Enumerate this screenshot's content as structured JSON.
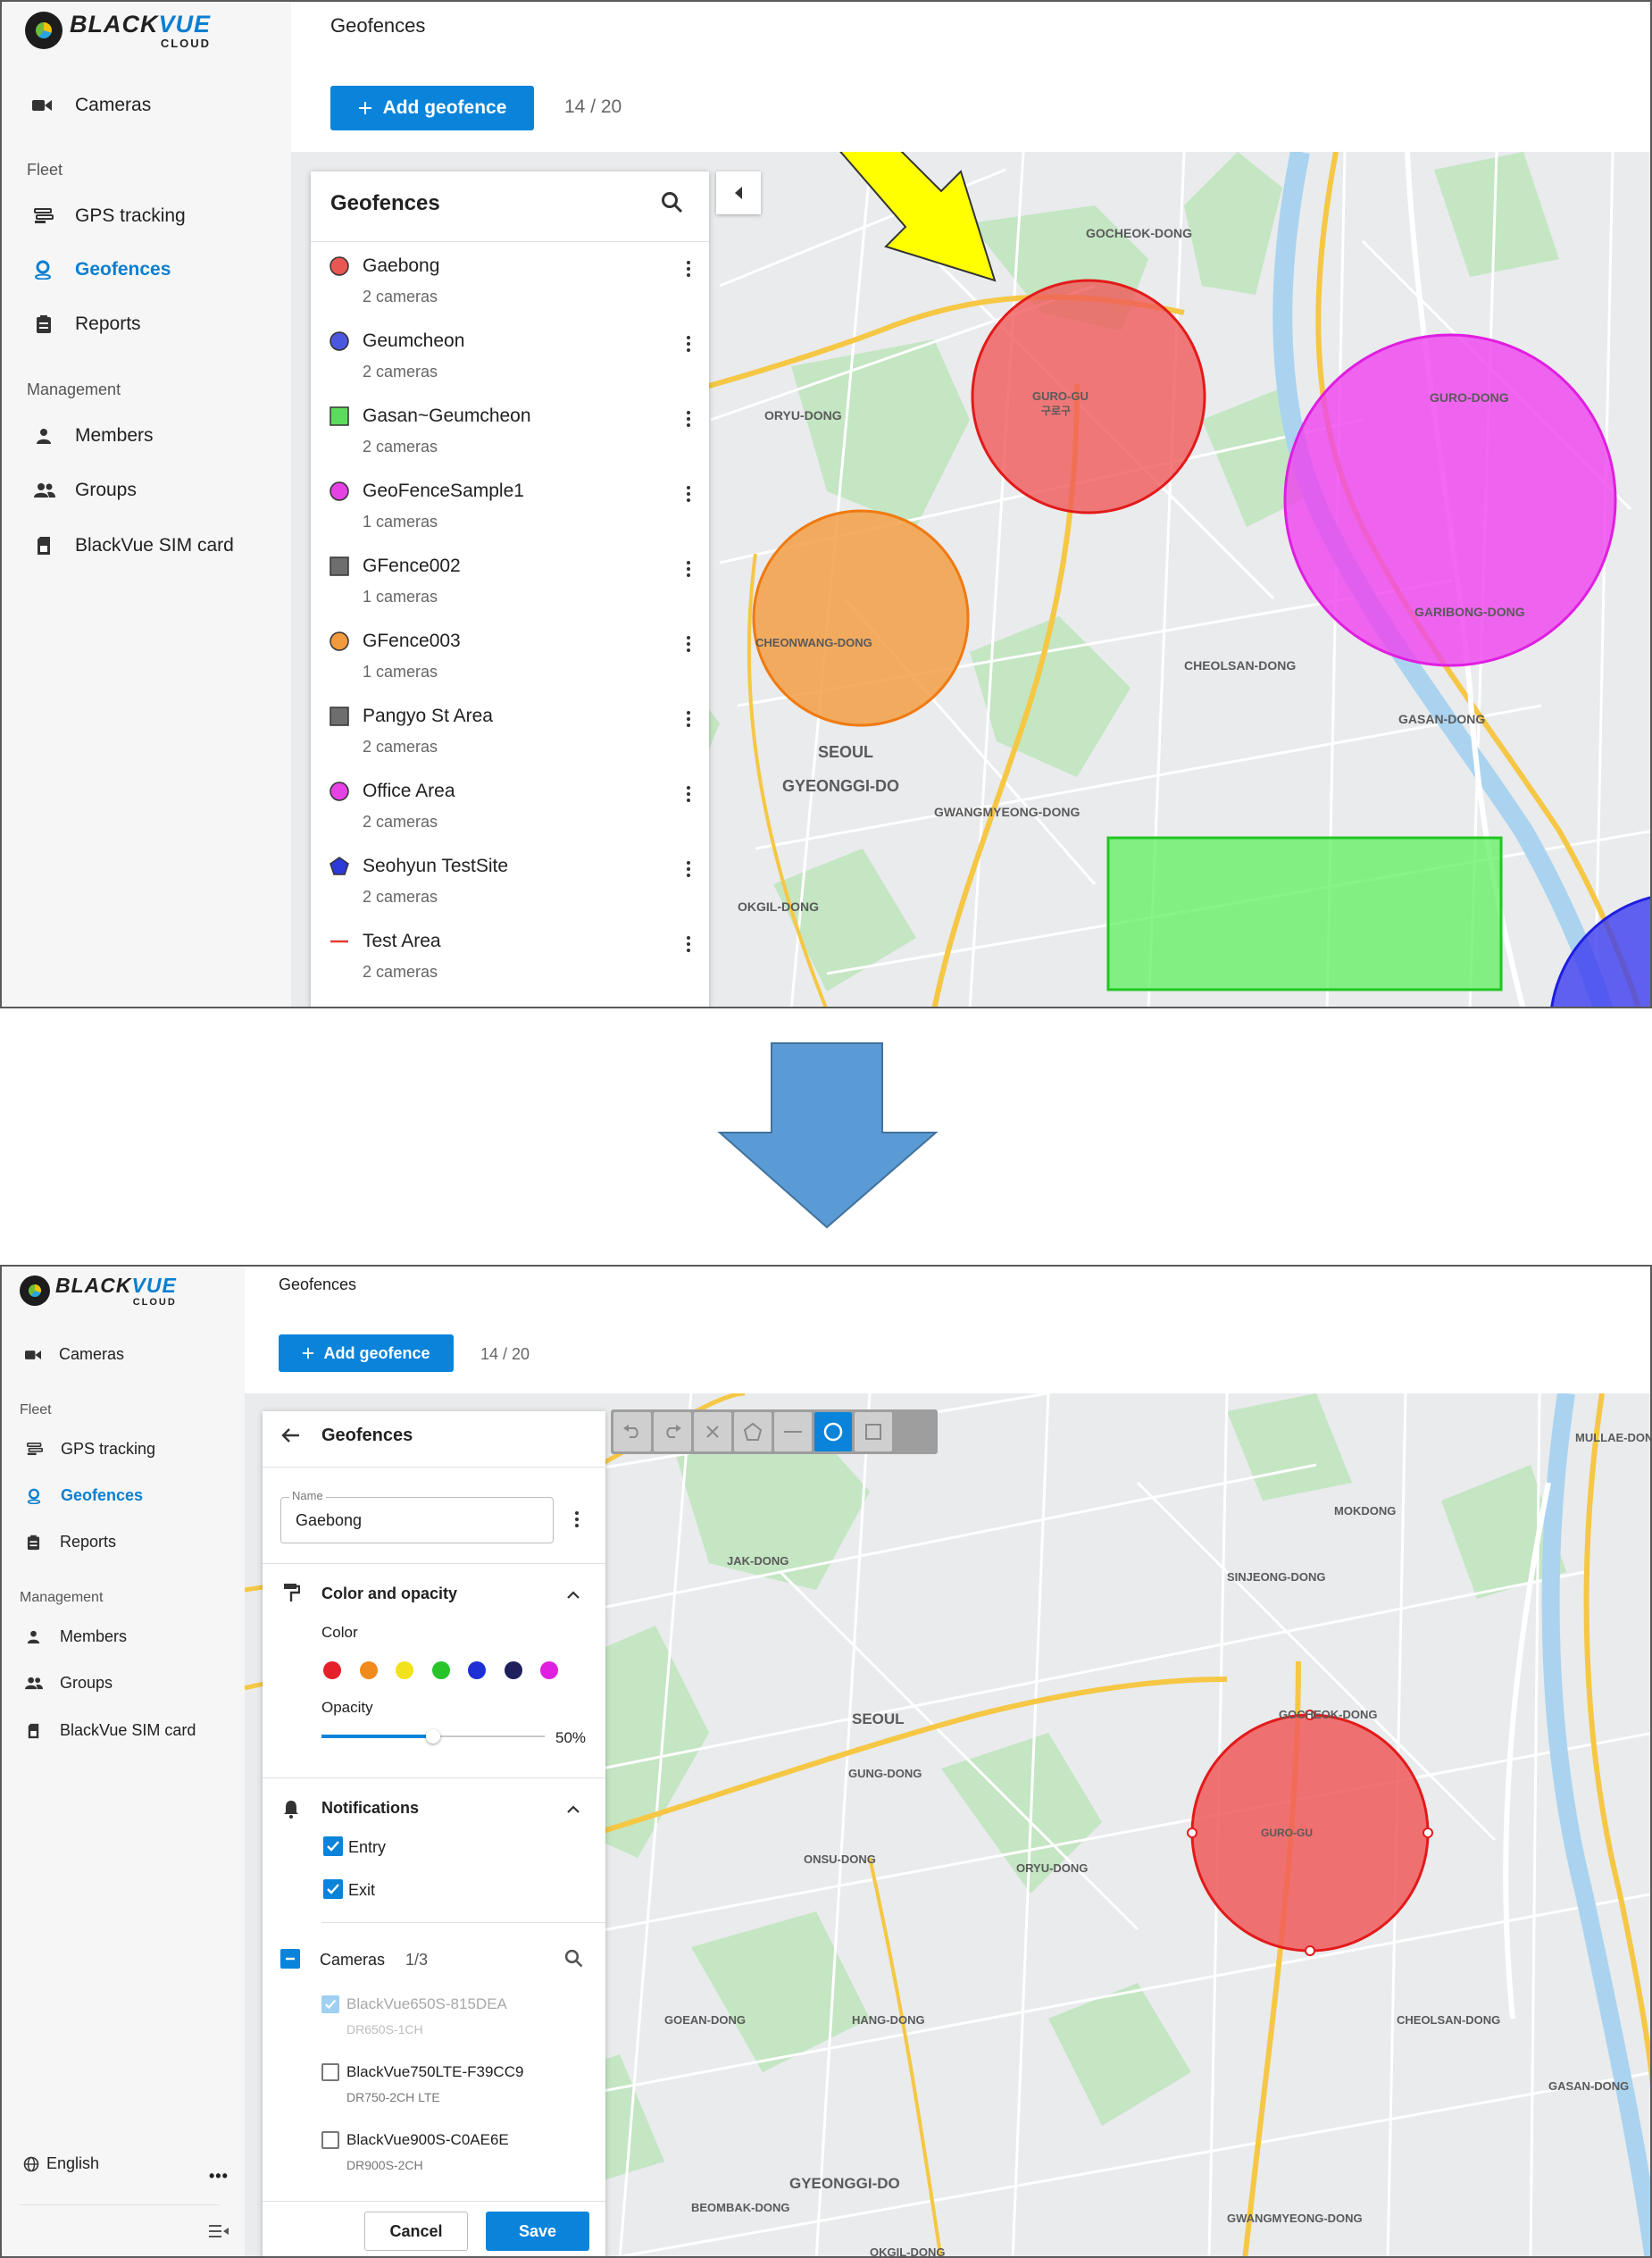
{
  "brand": {
    "black": "BLACK",
    "vue": "VUE",
    "sub": "CLOUD"
  },
  "nav": {
    "cameras": "Cameras",
    "fleet": "Fleet",
    "gps": "GPS tracking",
    "geofences": "Geofences",
    "reports": "Reports",
    "management": "Management",
    "members": "Members",
    "groups": "Groups",
    "sim": "BlackVue SIM card"
  },
  "page_title": "Geofences",
  "add_button": "Add geofence",
  "counter": "14 / 20",
  "list_panel": {
    "title": "Geofences",
    "items": [
      {
        "name": "Gaebong",
        "sub": "2 cameras",
        "color": "#e53935",
        "shape": "circle"
      },
      {
        "name": "Geumcheon",
        "sub": "2 cameras",
        "color": "#2b3ad9",
        "shape": "circle"
      },
      {
        "name": "Gasan~Geumcheon",
        "sub": "2 cameras",
        "color": "#3fd63f",
        "shape": "square"
      },
      {
        "name": "GeoFenceSample1",
        "sub": "1 cameras",
        "color": "#e020e0",
        "shape": "circle"
      },
      {
        "name": "GFence002",
        "sub": "1 cameras",
        "color": "#555555",
        "shape": "square"
      },
      {
        "name": "GFence003",
        "sub": "1 cameras",
        "color": "#f08a1c",
        "shape": "circle"
      },
      {
        "name": "Pangyo St Area",
        "sub": "2 cameras",
        "color": "#555555",
        "shape": "square"
      },
      {
        "name": "Office Area",
        "sub": "2 cameras",
        "color": "#e020e0",
        "shape": "circle"
      },
      {
        "name": "Seohyun TestSite",
        "sub": "2 cameras",
        "color": "#2b3ad9",
        "shape": "pentagon"
      },
      {
        "name": "Test Area",
        "sub": "2 cameras",
        "color": "#e53935",
        "shape": "line"
      }
    ]
  },
  "map_labels_top": {
    "gocheok": "GOCHEOK-DONG",
    "guro": "GURO-GU",
    "guro_kr": "구로구",
    "oryu": "ORYU-DONG",
    "guro_dong": "GURO-DONG",
    "garibong": "GARIBONG-DONG",
    "cheonwang": "CHEONWANG-DONG",
    "cheolsan": "CHEOLSAN-DONG",
    "seoul": "SEOUL",
    "gyeonggi": "GYEONGGI-DO",
    "gasan": "GASAN-DONG",
    "gwangmyeong": "GWANGMYEONG-DONG",
    "okgil": "OKGIL-DONG"
  },
  "edit_panel": {
    "title": "Geofences",
    "name_label": "Name",
    "name_value": "Gaebong",
    "color_section": "Color and opacity",
    "color_label": "Color",
    "colors": [
      "#e5202a",
      "#f08a1c",
      "#f2e21c",
      "#27c52a",
      "#1e2fd6",
      "#1f1f5c",
      "#e020e0"
    ],
    "opacity_label": "Opacity",
    "opacity": 0.5,
    "opacity_text": "50%",
    "notifications": "Notifications",
    "entry": "Entry",
    "exit": "Exit",
    "cameras_label": "Cameras",
    "cameras_count": "1/3",
    "cameras": [
      {
        "name": "BlackVue650S-815DEA",
        "model": "DR650S-1CH",
        "checked": true
      },
      {
        "name": "BlackVue750LTE-F39CC9",
        "model": "DR750-2CH LTE",
        "checked": false
      },
      {
        "name": "BlackVue900S-C0AE6E",
        "model": "DR900S-2CH",
        "checked": false
      }
    ],
    "cancel": "Cancel",
    "save": "Save"
  },
  "language": "English",
  "map_labels_bottom": {
    "gocheok": "GOCHEOK-DONG",
    "guro": "GURO-GU",
    "oryu": "ORYU-DONG",
    "onsu": "ONSU-DONG",
    "gung": "GUNG-DONG",
    "sinjeong": "SINJEONG-DONG",
    "mokdong": "MOKDONG",
    "jak": "JAK-DONG",
    "seoul": "SEOUL",
    "gyeonggi": "GYEONGGI-DO",
    "cheolsan": "CHEOLSAN-DONG",
    "gwangmyeong": "GWANGMYEONG-DONG",
    "goean": "GOEAN-DONG",
    "hang": "HANG-DONG",
    "gasan": "GASAN-DONG",
    "beombak": "BEOMBAK-DONG",
    "oksil": "OKGIL-DONG",
    "mullae": "MULLAE-DONG"
  },
  "colors": {
    "accent": "#0a84db",
    "arrow_down": "#5b9bd5",
    "yellow_arrow": "#ffff00"
  }
}
